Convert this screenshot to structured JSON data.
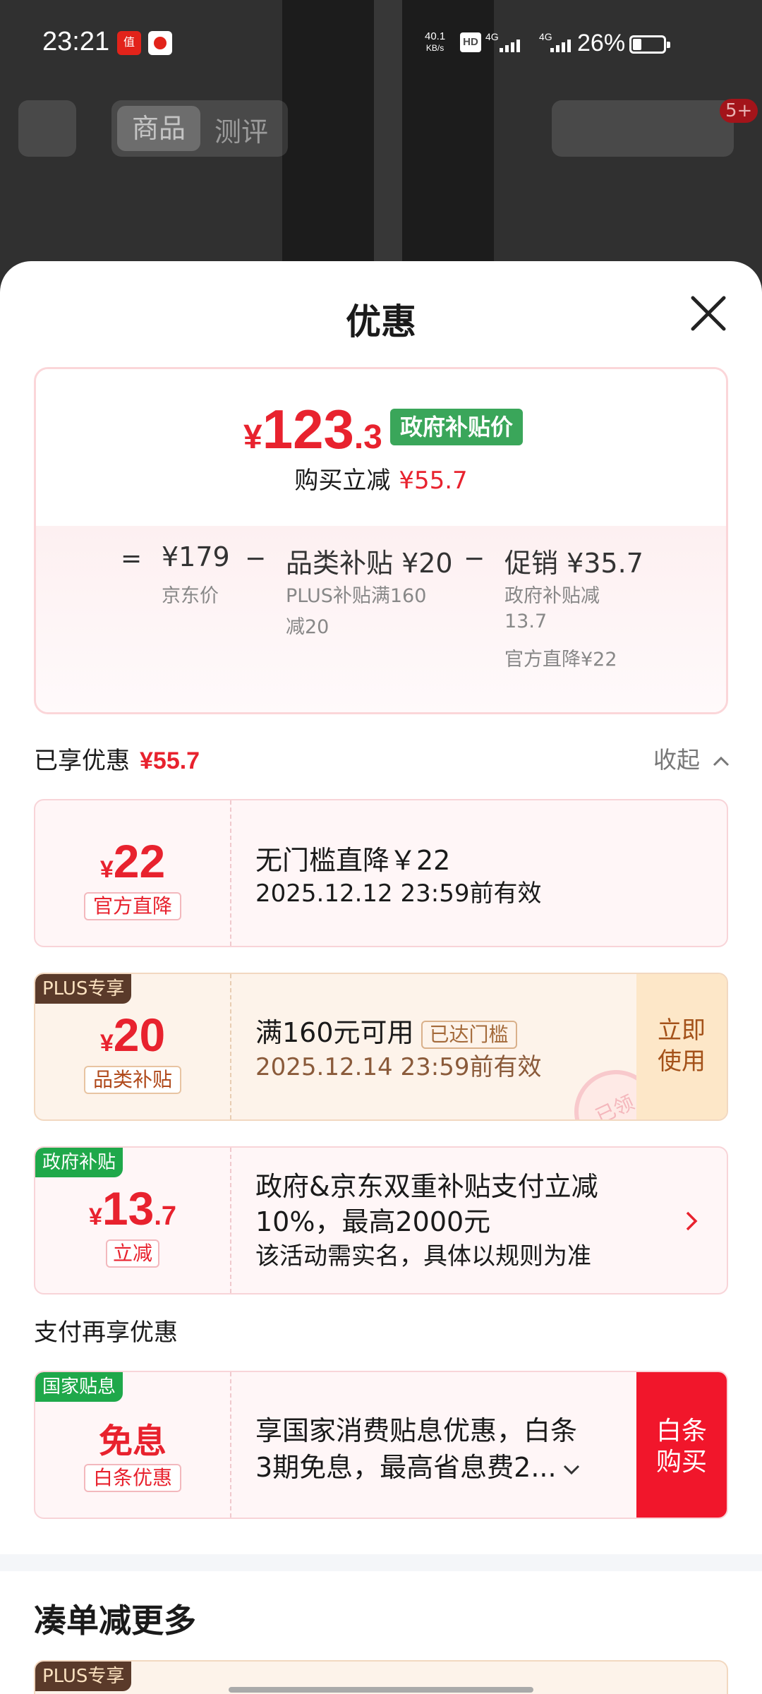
{
  "status_bar": {
    "time": "23:21",
    "app_icon_1_label": "值",
    "net_speed_value": "40.1",
    "net_speed_unit": "KB/s",
    "hd_label": "HD",
    "sim1": "4G",
    "sim2": "4G",
    "battery": "26%"
  },
  "header": {
    "tab_product": "商品",
    "tab_review": "测评",
    "cart_badge": "5+"
  },
  "sheet": {
    "title": "优惠",
    "summary": {
      "currency": "¥",
      "price_int": "123",
      "price_dec": ".3",
      "gov_tag": "政府补贴价",
      "reduce_label": "购买立减",
      "reduce_amount": "¥55.7",
      "eq": "=",
      "minus": "−",
      "jd_price": "¥179",
      "jd_price_label": "京东价",
      "category_sub": "品类补贴 ¥20",
      "category_sub_label_1": "PLUS补贴满160",
      "category_sub_label_2": "减20",
      "promo": "促销 ¥35.7",
      "promo_label_1": "政府补贴减",
      "promo_label_2": "13.7",
      "promo_label_3": "官方直降¥22"
    },
    "enjoyed": {
      "label": "已享优惠",
      "amount": "¥55.7",
      "collapse": "收起"
    },
    "coupons": [
      {
        "currency": "¥",
        "int": "22",
        "dec": "",
        "tag": "官方直降",
        "title": "无门槛直降￥22",
        "validity": "2025.12.12 23:59前有效"
      },
      {
        "corner": "PLUS专享",
        "currency": "¥",
        "int": "20",
        "dec": "",
        "tag": "品类补贴",
        "title": "满160元可用",
        "reached": "已达门槛",
        "validity": "2025.12.14 23:59前有效",
        "action": "立即使用",
        "action_1": "立即",
        "action_2": "使用",
        "stamp": "已领"
      },
      {
        "corner": "政府补贴",
        "currency": "¥",
        "int": "13",
        "dec": ".7",
        "tag": "立减",
        "line1": "政府&京东双重补贴支付立减",
        "line2": "10%，最高2000元",
        "line3": "该活动需实名，具体以规则为准"
      }
    ],
    "pay_section": {
      "label": "支付再享优惠",
      "corner": "国家贴息",
      "main": "免息",
      "tag": "白条优惠",
      "line1": "享国家消费贴息优惠，白条",
      "line2": "3期免息，最高省息费2...",
      "action_1": "白条",
      "action_2": "购买"
    },
    "more": {
      "title": "凑单减更多",
      "corner": "PLUS专享"
    }
  },
  "colors": {
    "accent_red": "#e8222e",
    "gov_green": "#3aa65a",
    "plus_brown": "#5a3a2a",
    "buy_red": "#f1162b"
  }
}
